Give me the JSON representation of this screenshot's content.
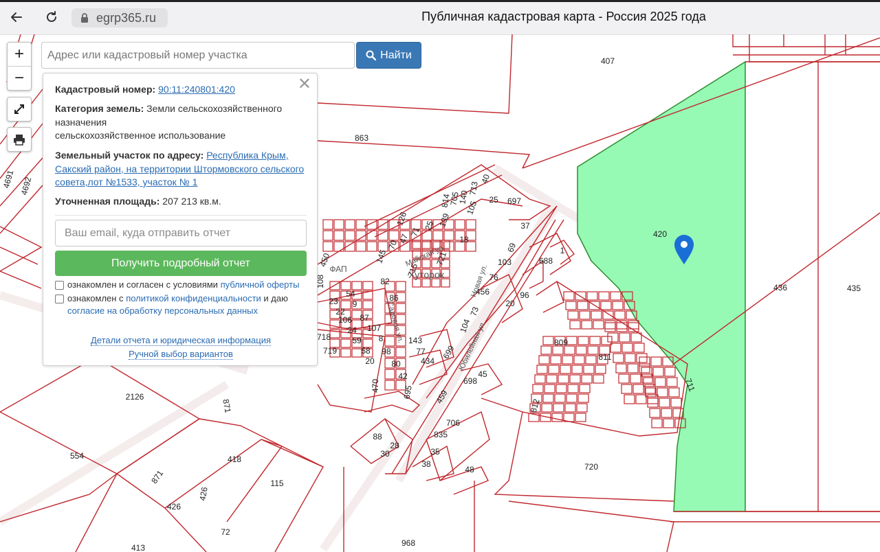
{
  "browser": {
    "url": "egrp365.ru",
    "tab_title": "Публичная кадастровая карта - Россия 2025 года"
  },
  "map_controls": {
    "zoom_in": "+",
    "zoom_out": "−"
  },
  "search": {
    "placeholder": "Адрес или кадастровый номер участка",
    "button_label": "Найти"
  },
  "info_panel": {
    "cadastral_label": "Кадастровый номер:",
    "cadastral_value": "90:11:240801:420",
    "category_label": "Категория земель:",
    "category_value_line1": "Земли сельскохозяйственного",
    "category_value_line2": "назначения",
    "category_use": "сельскохозяйственное использование",
    "address_label": "Земельный участок по адресу:",
    "address_line1": "Республика Крым,",
    "address_line2": "Сакский район, на территории Штормовского сельского",
    "address_line3": "совета,лот №1533, участок № 1",
    "area_label": "Уточненная площадь:",
    "area_value": "207 213 кв.м.",
    "email_placeholder": "Ваш email, куда отправить отчет",
    "report_button": "Получить подробный отчет",
    "consent1_text": "ознакомлен и согласен с условиями",
    "consent1_link": "публичной оферты",
    "consent2_text_a": "ознакомлен с",
    "consent2_link_a": "политикой конфиденциальности",
    "consent2_text_b": "и даю",
    "consent2_link_b": "согласие на обработку персональных данных",
    "details_link": "Детали отчета и юридическая информация",
    "manual_link": "Ручной выбор вариантов"
  },
  "map": {
    "highlight_color": "#96f9b4",
    "line_color": "#c0272d",
    "marker_color": "#1a6fd6",
    "parcel_labels": [
      {
        "text": "407"
      },
      {
        "text": "863"
      },
      {
        "text": "420"
      },
      {
        "text": "436"
      },
      {
        "text": "435"
      },
      {
        "text": "720"
      },
      {
        "text": "968"
      },
      {
        "text": "2126"
      },
      {
        "text": "554"
      },
      {
        "text": "418"
      },
      {
        "text": "115"
      },
      {
        "text": "426"
      },
      {
        "text": "426"
      },
      {
        "text": "72"
      },
      {
        "text": "413"
      },
      {
        "text": "871"
      },
      {
        "text": "871"
      },
      {
        "text": "4691"
      },
      {
        "text": "4692"
      },
      {
        "text": "809"
      },
      {
        "text": "811"
      },
      {
        "text": "812"
      },
      {
        "text": "711"
      },
      {
        "text": "688"
      },
      {
        "text": "697"
      },
      {
        "text": "37"
      },
      {
        "text": "69"
      },
      {
        "text": "103"
      },
      {
        "text": "76"
      },
      {
        "text": "96"
      },
      {
        "text": "456"
      },
      {
        "text": "73"
      },
      {
        "text": "104"
      },
      {
        "text": "699"
      },
      {
        "text": "45"
      },
      {
        "text": "698"
      },
      {
        "text": "459"
      },
      {
        "text": "706"
      },
      {
        "text": "835"
      },
      {
        "text": "35"
      },
      {
        "text": "38"
      },
      {
        "text": "48"
      },
      {
        "text": "88"
      },
      {
        "text": "28"
      },
      {
        "text": "30"
      },
      {
        "text": "470"
      },
      {
        "text": "695"
      },
      {
        "text": "42"
      },
      {
        "text": "80"
      },
      {
        "text": "98"
      },
      {
        "text": "20"
      },
      {
        "text": "58"
      },
      {
        "text": "59"
      },
      {
        "text": "24"
      },
      {
        "text": "106"
      },
      {
        "text": "22"
      },
      {
        "text": "23"
      },
      {
        "text": "718"
      },
      {
        "text": "719"
      },
      {
        "text": "143"
      },
      {
        "text": "77"
      },
      {
        "text": "434"
      },
      {
        "text": "86"
      },
      {
        "text": "82"
      },
      {
        "text": "108"
      },
      {
        "text": "450"
      },
      {
        "text": "145"
      },
      {
        "text": "70"
      },
      {
        "text": "47"
      },
      {
        "text": "71"
      },
      {
        "text": "25"
      },
      {
        "text": "139"
      },
      {
        "text": "126"
      },
      {
        "text": "105"
      },
      {
        "text": "140"
      },
      {
        "text": "705"
      },
      {
        "text": "814"
      },
      {
        "text": "713"
      },
      {
        "text": "40"
      },
      {
        "text": "715"
      },
      {
        "text": "721"
      },
      {
        "text": "54"
      },
      {
        "text": "87"
      },
      {
        "text": "107"
      },
      {
        "text": "8"
      },
      {
        "text": "9"
      },
      {
        "text": "1"
      },
      {
        "text": "25"
      },
      {
        "text": "18"
      },
      {
        "text": "20"
      }
    ],
    "street_labels": [
      {
        "text": "Майская ул."
      },
      {
        "text": "Новая ул."
      },
      {
        "text": "Юбилейная ул."
      },
      {
        "text": "Садовая ул."
      },
      {
        "text": "Хуторок"
      },
      {
        "text": "ФАП"
      }
    ]
  }
}
